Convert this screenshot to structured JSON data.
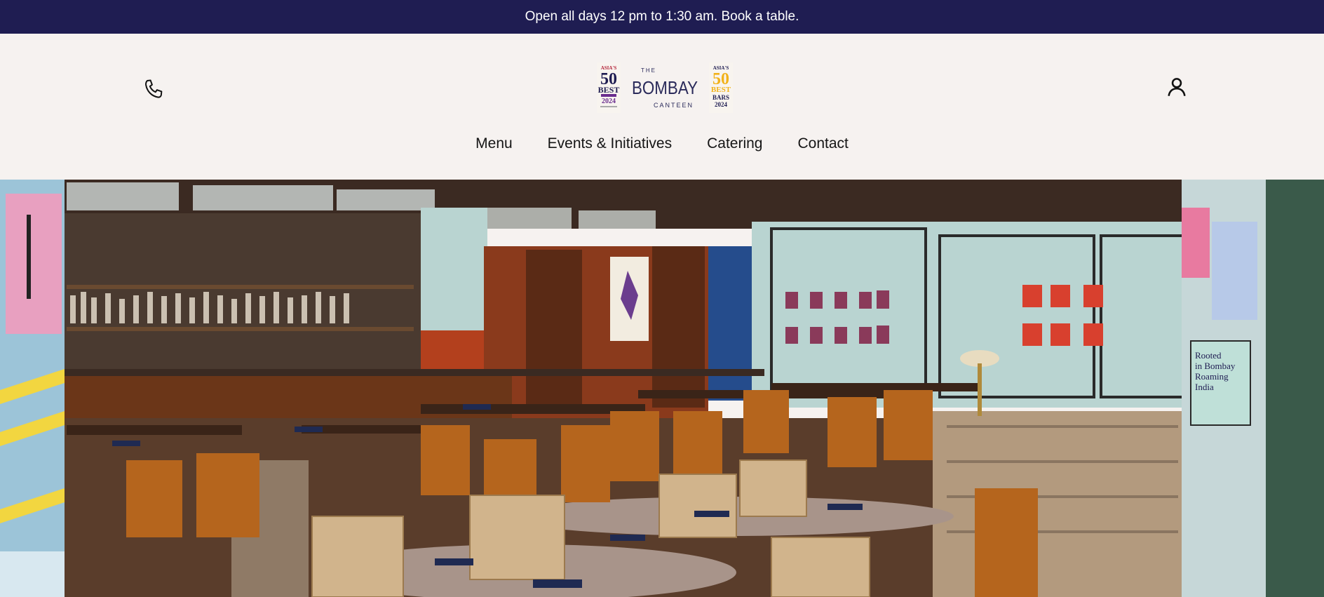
{
  "announcement": {
    "text": "Open all days 12 pm to 1:30 am. Book a table."
  },
  "header": {
    "logo": {
      "name_the": "THE",
      "name_main": "BOMBAY",
      "name_sub": "CANTEEN",
      "badge_left": {
        "top": "ASIA'S",
        "num": "50",
        "word": "BEST",
        "year": "2024"
      },
      "badge_right": {
        "top": "ASIA'S",
        "num": "50",
        "word": "BEST",
        "sub": "BARS",
        "year": "2024"
      }
    },
    "icons": {
      "phone": "phone-icon",
      "account": "account-icon"
    }
  },
  "nav": {
    "items": [
      {
        "label": "Menu"
      },
      {
        "label": "Events & Initiatives"
      },
      {
        "label": "Catering"
      },
      {
        "label": "Contact"
      }
    ]
  },
  "hero": {
    "poster_text": "Rooted in Bombay Roaming India",
    "colors": {
      "wall": "#b9d4d1",
      "wood": "#a85b24",
      "navy": "#1f1d52",
      "curtain": "#254c8c"
    }
  }
}
